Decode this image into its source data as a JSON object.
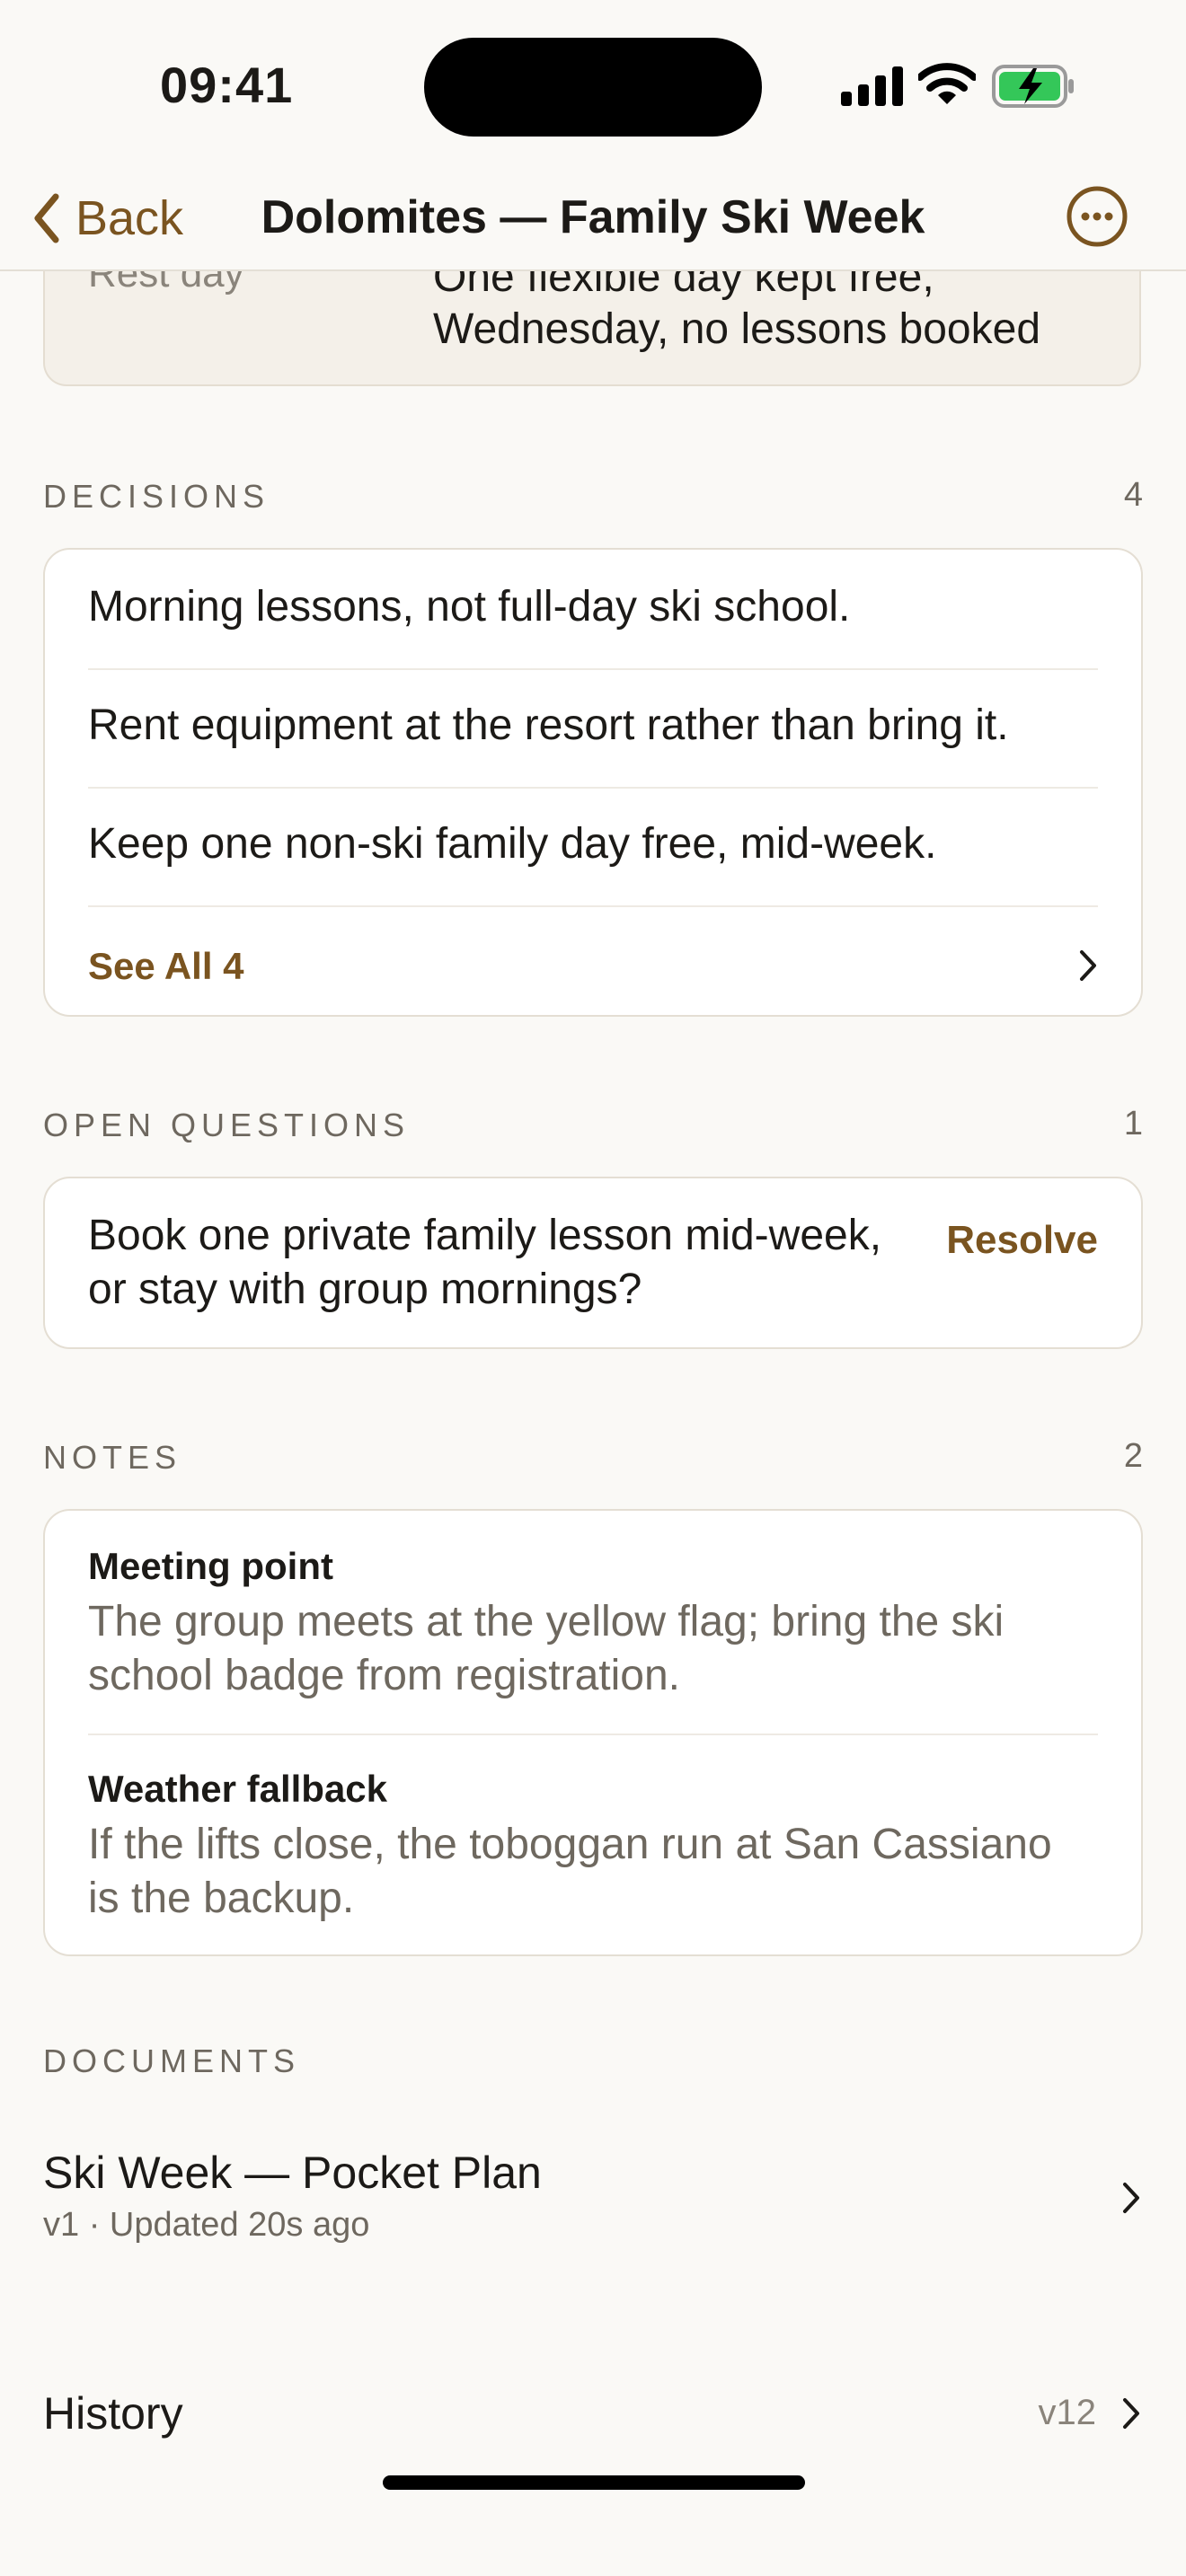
{
  "status": {
    "time": "09:41"
  },
  "nav": {
    "back_label": "Back",
    "title": "Dolomites — Family Ski Week"
  },
  "rest_day": {
    "label": "Rest day",
    "value": "One flexible day kept free, Wednesday, no lessons booked"
  },
  "decisions": {
    "heading": "DECISIONS",
    "count": "4",
    "items": [
      "Morning lessons, not full-day ski school.",
      "Rent equipment at the resort rather than bring it.",
      "Keep one non-ski family day free, mid-week."
    ],
    "see_all_label": "See All 4"
  },
  "open_questions": {
    "heading": "OPEN QUESTIONS",
    "count": "1",
    "items": [
      {
        "text": "Book one private family lesson mid-week, or stay with group mornings?",
        "action": "Resolve"
      }
    ]
  },
  "notes": {
    "heading": "NOTES",
    "count": "2",
    "items": [
      {
        "title": "Meeting point",
        "body": "The group meets at the yellow flag; bring the ski school badge from registration."
      },
      {
        "title": "Weather fallback",
        "body": "If the lifts close, the toboggan run at San Cassiano is the backup."
      }
    ]
  },
  "documents": {
    "heading": "DOCUMENTS",
    "items": [
      {
        "title": "Ski Week — Pocket Plan",
        "meta": "v1 · Updated 20s ago"
      }
    ]
  },
  "history": {
    "label": "History",
    "value": "v12"
  },
  "colors": {
    "accent": "#7A5420",
    "background": "#FAF9F6",
    "card": "#FFFFFF",
    "battery_green": "#34C759"
  }
}
